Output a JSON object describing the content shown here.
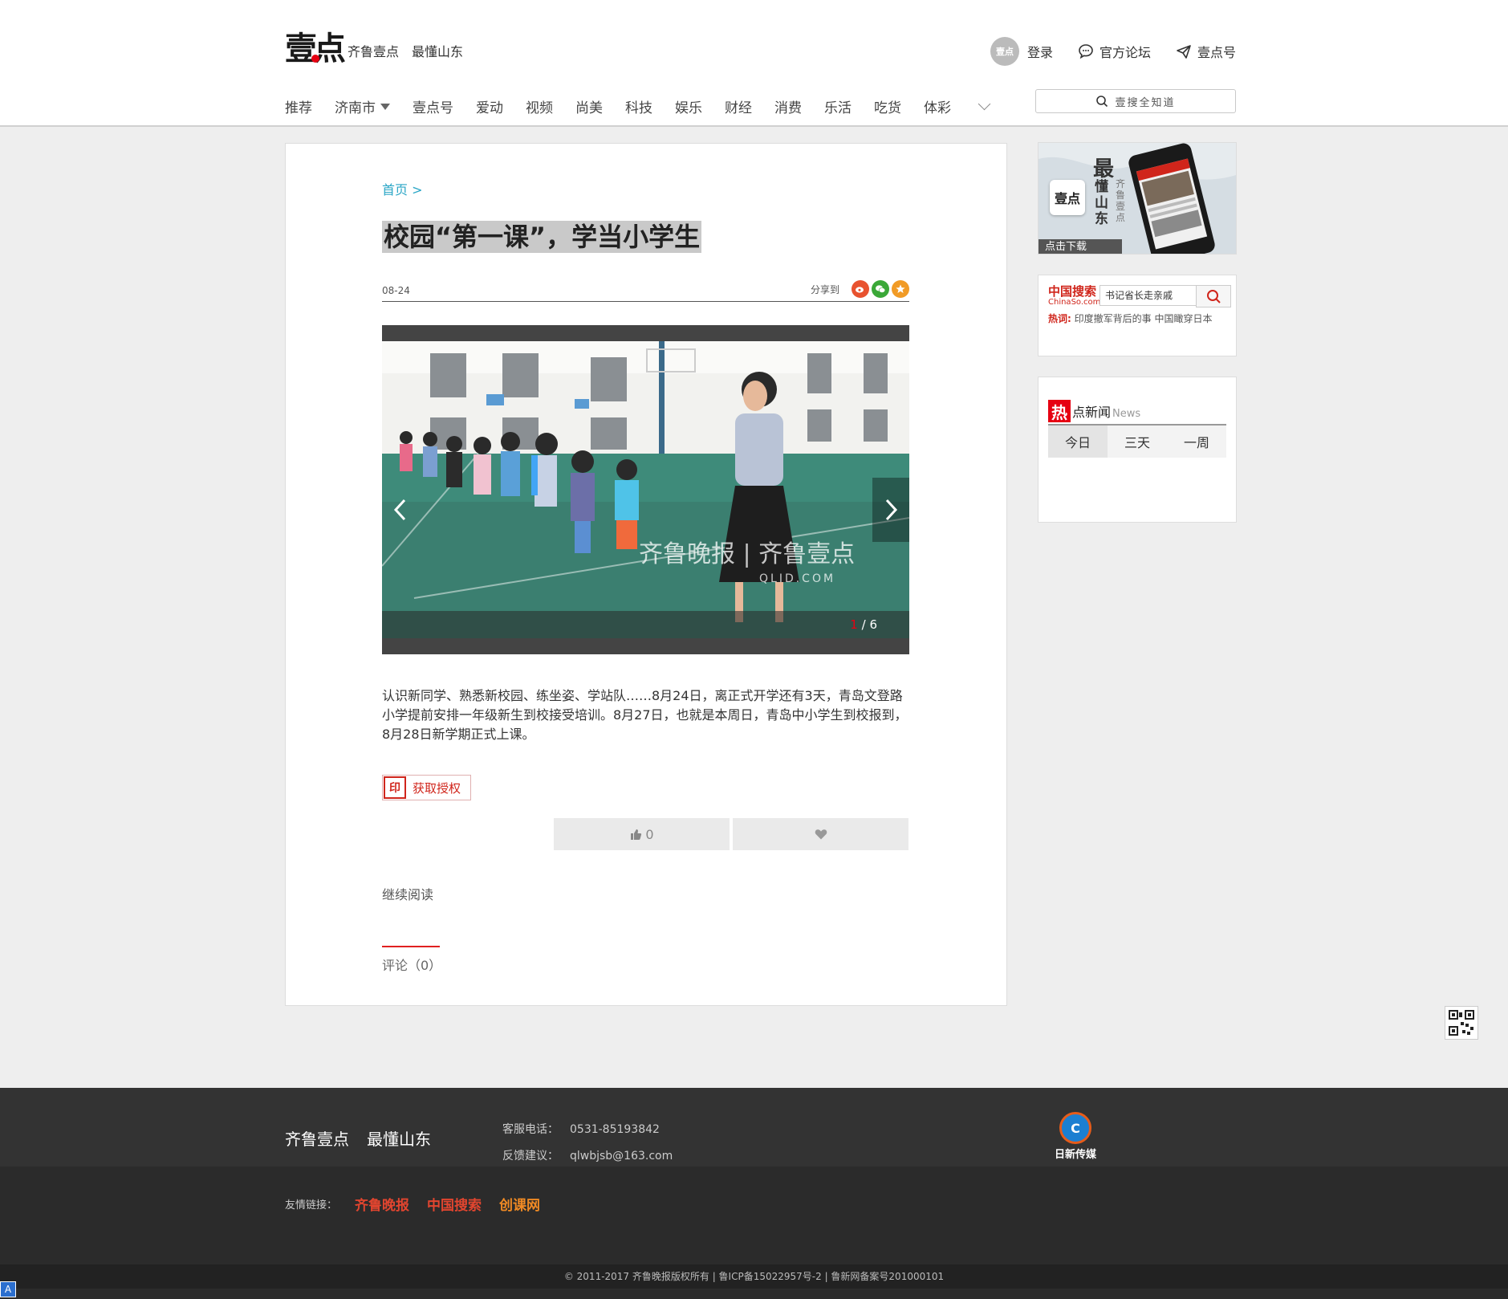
{
  "header": {
    "logo_text": "壹点",
    "slogan": [
      "齐鲁壹点",
      "最懂山东"
    ],
    "top_links": {
      "avatar_text": "壹点",
      "login": "登录",
      "forum": "官方论坛",
      "account": "壹点号"
    },
    "nav": [
      "推荐",
      "济南市",
      "壹点号",
      "爱动",
      "视频",
      "尚美",
      "科技",
      "娱乐",
      "财经",
      "消费",
      "乐活",
      "吃货",
      "体彩"
    ],
    "search_placeholder": "壹搜全知道"
  },
  "article": {
    "breadcrumb": "首页 >",
    "title": "校园“第一课”，学当小学生",
    "date": "08-24",
    "share_label": "分享到",
    "gallery": {
      "current": "1",
      "total": "/ 6",
      "watermark": "齐鲁晚报 | 齐鲁壹点",
      "watermark_sub": "QLID.COM"
    },
    "body": "认识新同学、熟悉新校园、练坐姿、学站队……8月24日，离正式开学还有3天，青岛文登路小学提前安排一年级新生到校接受培训。8月27日，也就是本周日，青岛中小学生到校报到，8月28日新学期正式上课。",
    "auth_icon": "印",
    "auth_label": "获取授权",
    "like_count": "0",
    "continue_label": "继续阅读",
    "comments_label": "评论（0）"
  },
  "sidebar": {
    "app_ad": {
      "icon_text": "壹点",
      "big": "最",
      "vertical": "懂山东",
      "vertical_small": "齐鲁壹点",
      "download": "点击下载"
    },
    "chinaso": {
      "logo_cn": "中国搜索",
      "logo_en": "ChinaSo.com",
      "input_value": "书记省长走亲戚",
      "hot_label": "热词:",
      "hot_items": "印度撤军背后的事  中国瞰穿日本"
    },
    "hot_news": {
      "re": "热",
      "title": "点新闻",
      "news": "News",
      "tabs": [
        "今日",
        "三天",
        "一周"
      ]
    }
  },
  "footer": {
    "brand": [
      "齐鲁壹点",
      "最懂山东"
    ],
    "phone_label": "客服电话：",
    "phone": "0531-85193842",
    "feedback_label": "反馈建议：",
    "email": "qlwbjsb@163.com",
    "partner_logo": "日新传媒",
    "friend_links_label": "友情链接：",
    "friend_links": [
      "齐鲁晚报",
      "中国搜索",
      "创课网"
    ],
    "copyright": "© 2011-2017  齐鲁晚报版权所有  |  鲁ICP备15022957号-2  |  鲁新网备案号201000101"
  },
  "colors": {
    "accent_red": "#e60012",
    "link_blue": "#2aa6c6",
    "footer_bg": "#2b2b2b"
  }
}
